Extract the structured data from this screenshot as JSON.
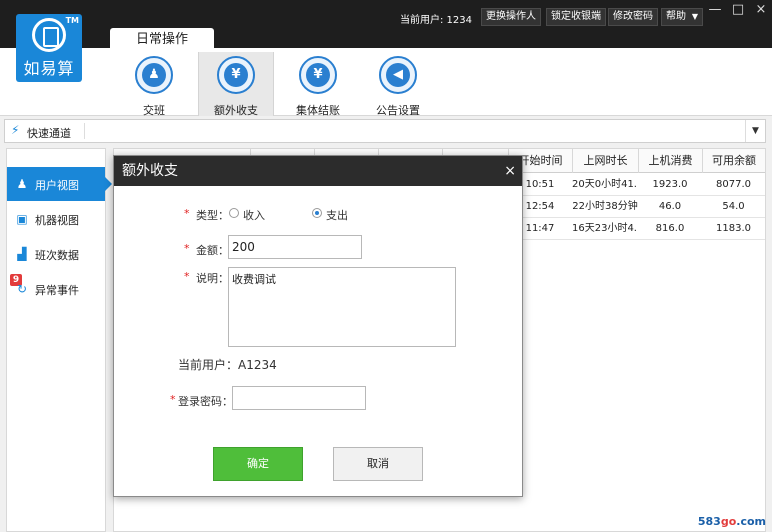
{
  "header": {
    "logo_text": "如易算",
    "logo_tm": "TM",
    "current_user": "当前用户: 1234",
    "buttons": {
      "change_operator": "更换操作人",
      "lock_cashier": "锁定收银端",
      "change_password": "修改密码",
      "help": "帮助"
    },
    "window": {
      "minimize": "—",
      "maximize": "□",
      "close": "×"
    }
  },
  "tabs": {
    "active": "日常操作"
  },
  "toolbar": {
    "items": [
      {
        "label": "交班",
        "icon": "handover-icon"
      },
      {
        "label": "额外收支",
        "icon": "yen-icon"
      },
      {
        "label": "集体结账",
        "icon": "checkout-icon"
      },
      {
        "label": "公告设置",
        "icon": "megaphone-icon"
      }
    ]
  },
  "quick_channel": {
    "label": "快速通道"
  },
  "sidebar": {
    "items": [
      {
        "label": "用户视图"
      },
      {
        "label": "机器视图"
      },
      {
        "label": "班次数据"
      },
      {
        "label": "异常事件",
        "badge": "9"
      }
    ]
  },
  "table": {
    "headers": [
      "开始时间",
      "上网时长",
      "上机消费",
      "可用余额"
    ],
    "rows": [
      [
        "10:51",
        "20天0小时41...",
        "1923.0",
        "8077.0"
      ],
      [
        "12:54",
        "22小时38分钟",
        "46.0",
        "54.0"
      ],
      [
        "11:47",
        "16天23小时4...",
        "816.0",
        "1183.0"
      ]
    ]
  },
  "dialog": {
    "title": "额外收支",
    "close": "×",
    "required_mark": "*",
    "type_label": "类型：",
    "type_income": "收入",
    "type_expense": "支出",
    "type_selected": "支出",
    "amount_label": "金额：",
    "amount_value": "200",
    "note_label": "说明：",
    "note_value": "收费调试",
    "current_user": "当前用户：A1234",
    "password_label": "登录密码：",
    "password_value": "",
    "ok_label": "确定",
    "cancel_label": "取消"
  },
  "watermark": {
    "left": "583",
    "mid": "go",
    "right": ".com"
  },
  "colors": {
    "accent_blue": "#1a87d8",
    "title_dark": "#2c2c2c",
    "ok_green": "#4fbe3a",
    "required_red": "#e02020"
  }
}
